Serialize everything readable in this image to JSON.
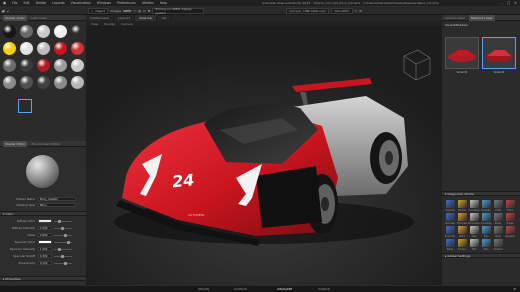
{
  "app": {
    "title": "Autodesk Alias AutoStudio 2026 - Vehicle_Concept_Race_Car.wire - C:\\Users\\Shared\\Autodesk\\Alias\\Car\\Race_Car.wire"
  },
  "menu": [
    "File",
    "Edit",
    "Delete",
    "Layouts",
    "Visualization",
    "Windows",
    "Preferences",
    "Utilities",
    "Help"
  ],
  "window_controls": [
    "–",
    "□",
    "✕"
  ],
  "toolbar": {
    "object": "Object",
    "images": "Images",
    "vred": "VRED",
    "message": "Turning on VRED display system",
    "camera": "Camera: CINE 4000 Cam",
    "zoom": "100.000%"
  },
  "shader_lister": {
    "title": "Shader Lister",
    "tab2": "Light lister"
  },
  "shader_balls": [
    "#161616",
    "#6a6a6a",
    "#c9c9c9",
    "#eeeeee",
    "#2c2c2c",
    "#f5d100",
    "#e3e3e3",
    "#bdbdbd",
    "#c8151f",
    "#d43138",
    "#6c6c6c",
    "#3b3b3b",
    "#b01c24",
    "#9c9c9c",
    "#c9c9c9",
    "#8a8a8a",
    "#515151",
    "#404040",
    "#8b8b8b",
    "#b8b8b8"
  ],
  "shader_editor": {
    "tab": "Shader Editor",
    "tab2": "Environment Editor"
  },
  "shader_fields": {
    "name_label": "Shader Name",
    "name_value": "Body_metallic",
    "type_label": "Shading Type",
    "type_value": "Blinn"
  },
  "color_section": "Color",
  "color_params": [
    {
      "label": "Diffuse Color",
      "value": ""
    },
    {
      "label": "Diffuse Intensity",
      "value": "1.000"
    },
    {
      "label": "Gloss",
      "value": "0.800"
    },
    {
      "label": "Specular Color",
      "value": ""
    },
    {
      "label": "Specular Intensity",
      "value": "1.000"
    },
    {
      "label": "Specular Rolloff",
      "value": "0.300"
    },
    {
      "label": "Eccentricity",
      "value": "0.100"
    }
  ],
  "properties_section": "Properties",
  "viewport": {
    "tabs": [
      "Untitled.wire",
      "Layout1",
      "Alias Car",
      "Car"
    ],
    "sub": [
      "View",
      "Display",
      "Camera"
    ]
  },
  "car_number": "24",
  "car_brand": "AUTODESK",
  "right_top": {
    "tab": "Variant Lister",
    "tab2": "Network Lister",
    "header": "VariantShaders",
    "variants": [
      "Variant1",
      "Variant2"
    ]
  },
  "diagnostic": {
    "title": "Diagnostic Shade",
    "items": [
      "Isophote",
      "Stripes",
      "Curvature",
      "Isoangle",
      "Draft",
      "Trims",
      "Normals",
      "Thickness",
      "Dimension",
      "Crossings",
      "Nurbs",
      "Edges",
      "Proximity",
      "Ortho",
      "Plan",
      "Topo",
      "Style",
      "Gaussian",
      "Zebra",
      "Contour",
      "Flat",
      "Wire",
      "Ambient"
    ]
  },
  "global_settings": "Global Settings",
  "workspaces": [
    "DESIGN",
    "SURFACE",
    "VISUALIZE",
    "MARKUP"
  ],
  "active_workspace": "VISUALIZE",
  "colors": {
    "accent_red": "#c8151f",
    "accent_dark": "#b01c24"
  }
}
